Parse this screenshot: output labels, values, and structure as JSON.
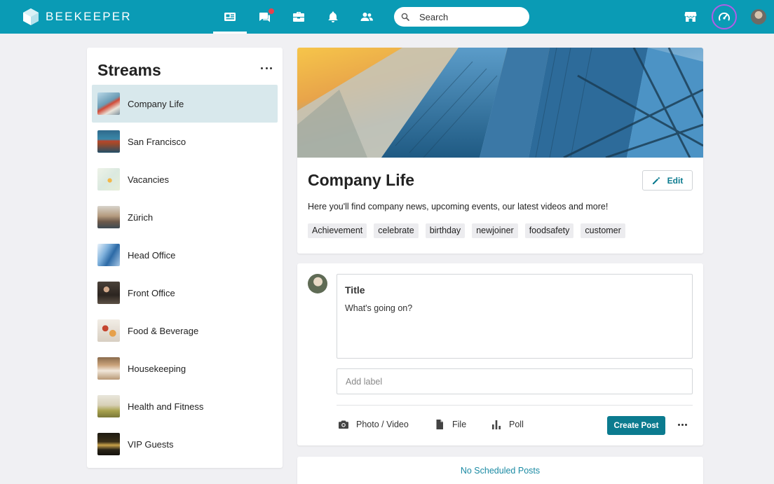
{
  "app": {
    "brand": "BEEKEEPER",
    "accent": "#0a9bb5",
    "primary_button": "#0b7b8f",
    "unread_badge": "#e8424d",
    "dashboard_ring": "#b25ce6"
  },
  "topbar": {
    "nav": [
      {
        "icon": "news-feed-icon",
        "active": true
      },
      {
        "icon": "chat-icon",
        "has_badge": true
      },
      {
        "icon": "toolbox-icon"
      },
      {
        "icon": "bell-icon"
      },
      {
        "icon": "people-icon"
      }
    ],
    "search": {
      "label": "Search"
    },
    "right_icons": [
      "store-icon",
      "dashboard-icon",
      "avatar"
    ]
  },
  "streams": {
    "title": "Streams",
    "items": [
      {
        "label": "Company Life",
        "selected": true
      },
      {
        "label": "San Francisco"
      },
      {
        "label": "Vacancies"
      },
      {
        "label": "Zürich"
      },
      {
        "label": "Head Office"
      },
      {
        "label": "Front Office"
      },
      {
        "label": "Food & Beverage"
      },
      {
        "label": "Housekeeping"
      },
      {
        "label": "Health and Fitness"
      },
      {
        "label": "VIP Guests"
      }
    ]
  },
  "stream_header": {
    "title": "Company Life",
    "edit_label": "Edit",
    "description": "Here you'll find company news, upcoming events, our latest videos and more!",
    "tags": [
      "Achievement",
      "celebrate",
      "birthday",
      "newjoiner",
      "foodsafety",
      "customer"
    ]
  },
  "composer": {
    "title_placeholder": "Title",
    "body_placeholder": "What's going on?",
    "label_placeholder": "Add label",
    "actions": {
      "photo_video": "Photo / Video",
      "file": "File",
      "poll": "Poll"
    },
    "create_label": "Create Post"
  },
  "scheduled": {
    "label": "No Scheduled Posts"
  }
}
